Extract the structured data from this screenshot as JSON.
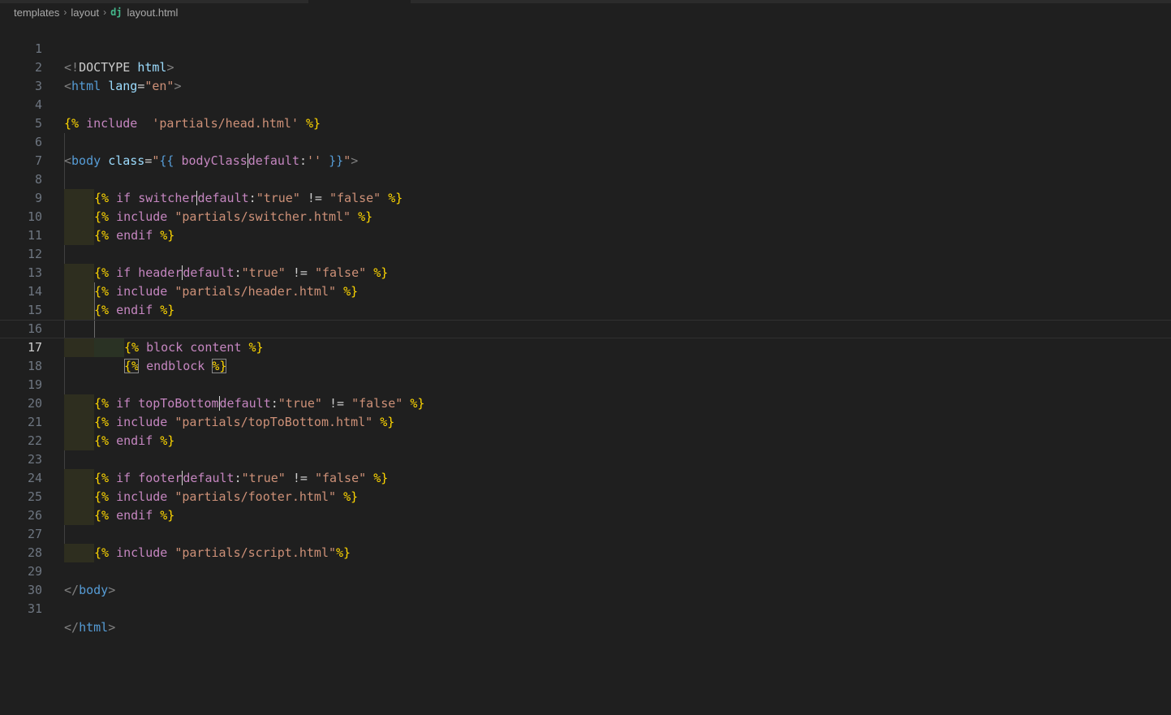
{
  "breadcrumb": {
    "segments": [
      "templates",
      "layout"
    ],
    "file_icon": "dj",
    "file": "layout.html"
  },
  "editor": {
    "current_line": 17,
    "lines": [
      {
        "n": "1"
      },
      {
        "n": "2"
      },
      {
        "n": "3"
      },
      {
        "n": "4"
      },
      {
        "n": "5"
      },
      {
        "n": "6"
      },
      {
        "n": "7"
      },
      {
        "n": "8"
      },
      {
        "n": "9"
      },
      {
        "n": "10"
      },
      {
        "n": "11"
      },
      {
        "n": "12"
      },
      {
        "n": "13"
      },
      {
        "n": "14"
      },
      {
        "n": "15"
      },
      {
        "n": "16"
      },
      {
        "n": "17"
      },
      {
        "n": "18"
      },
      {
        "n": "19"
      },
      {
        "n": "20"
      },
      {
        "n": "21"
      },
      {
        "n": "22"
      },
      {
        "n": "23"
      },
      {
        "n": "24"
      },
      {
        "n": "25"
      },
      {
        "n": "26"
      },
      {
        "n": "27"
      },
      {
        "n": "28"
      },
      {
        "n": "29"
      },
      {
        "n": "30"
      },
      {
        "n": "31"
      }
    ],
    "code": {
      "l1": [
        "<!",
        "DOCTYPE",
        " ",
        "html",
        ">"
      ],
      "l2": [
        "<",
        "html",
        " ",
        "lang",
        "=",
        "\"en\"",
        ">"
      ],
      "l4": [
        "{%",
        " ",
        "include",
        "  ",
        "'partials/head.html'",
        " ",
        "%}"
      ],
      "l6": [
        "<",
        "body",
        " ",
        "class",
        "=",
        "\"",
        "{{",
        " ",
        "bodyClass",
        "default",
        ":",
        "''",
        " ",
        "}}",
        "\"",
        ">"
      ],
      "l8": [
        "{%",
        " ",
        "if",
        " ",
        "switcher",
        "default",
        ":",
        "\"true\"",
        " != ",
        "\"false\"",
        " ",
        "%}"
      ],
      "l9": [
        "{%",
        " ",
        "include",
        " ",
        "\"partials/switcher.html\"",
        " ",
        "%}"
      ],
      "l10": [
        "{%",
        " ",
        "endif",
        " ",
        "%}"
      ],
      "l12": [
        "{%",
        " ",
        "if",
        " ",
        "header",
        "default",
        ":",
        "\"true\"",
        " != ",
        "\"false\"",
        " ",
        "%}"
      ],
      "l13": [
        "{%",
        " ",
        "include",
        " ",
        "\"partials/header.html\"",
        " ",
        "%}"
      ],
      "l14": [
        "{%",
        " ",
        "endif",
        " ",
        "%}"
      ],
      "l16": [
        "{%",
        " ",
        "block",
        " ",
        "content",
        " ",
        "%}"
      ],
      "l17": [
        "{%",
        " ",
        "endblock",
        " ",
        "%}"
      ],
      "l19": [
        "{%",
        " ",
        "if",
        " ",
        "topToBottom",
        "default",
        ":",
        "\"true\"",
        " != ",
        "\"false\"",
        " ",
        "%}"
      ],
      "l20": [
        "{%",
        " ",
        "include",
        " ",
        "\"partials/topToBottom.html\"",
        " ",
        "%}"
      ],
      "l21": [
        "{%",
        " ",
        "endif",
        " ",
        "%}"
      ],
      "l23": [
        "{%",
        " ",
        "if",
        " ",
        "footer",
        "default",
        ":",
        "\"true\"",
        " != ",
        "\"false\"",
        " ",
        "%}"
      ],
      "l24": [
        "{%",
        " ",
        "include",
        " ",
        "\"partials/footer.html\"",
        " ",
        "%}"
      ],
      "l25": [
        "{%",
        " ",
        "endif",
        " ",
        "%}"
      ],
      "l27": [
        "{%",
        " ",
        "include",
        " ",
        "\"partials/script.html\"",
        "%}"
      ],
      "l29": [
        "</",
        "body",
        ">"
      ],
      "l31": [
        "</",
        "html",
        ">"
      ]
    }
  },
  "colors": {
    "background": "#1f1f1f",
    "tag": "#569cd6",
    "attribute": "#9cdcfe",
    "string": "#ce9178",
    "template_delimiter": "#ffd700",
    "line_number": "#6e7681",
    "indent_highlight": "#2e2e1f"
  }
}
